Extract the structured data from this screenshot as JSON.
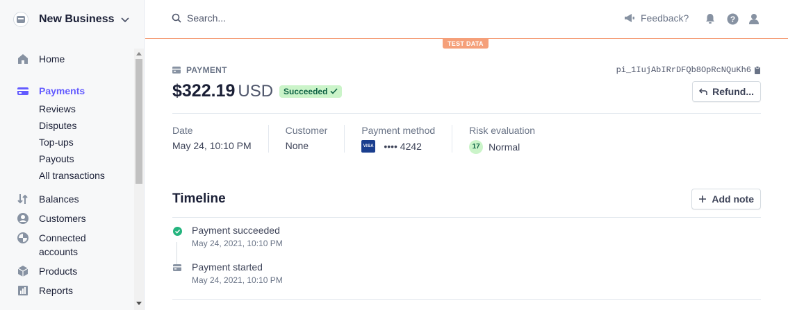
{
  "sidebar": {
    "business_name": "New Business",
    "items": [
      {
        "label": "Home",
        "icon": "home-icon"
      },
      {
        "label": "Payments",
        "icon": "payments-icon",
        "active": true
      },
      {
        "label": "Balances",
        "icon": "balances-icon"
      },
      {
        "label": "Customers",
        "icon": "customers-icon"
      },
      {
        "label": "Connected accounts",
        "icon": "connected-accounts-icon"
      },
      {
        "label": "Products",
        "icon": "products-icon"
      },
      {
        "label": "Reports",
        "icon": "reports-icon"
      }
    ],
    "payments_subitems": [
      "Reviews",
      "Disputes",
      "Top-ups",
      "Payouts",
      "All transactions"
    ],
    "connected_accounts_lines": [
      "Connected",
      "accounts"
    ]
  },
  "topbar": {
    "search_placeholder": "Search...",
    "feedback_label": "Feedback?",
    "test_data_badge": "TEST DATA"
  },
  "payment": {
    "section_label": "PAYMENT",
    "id": "pi_1IujAbIRrDFQb8OpRcNQuKh6",
    "amount": "$322.19",
    "currency": "USD",
    "status": "Succeeded",
    "refund_label": "Refund..."
  },
  "summary": {
    "date_label": "Date",
    "date_value": "May 24, 10:10 PM",
    "customer_label": "Customer",
    "customer_value": "None",
    "method_label": "Payment method",
    "card_brand": "VISA",
    "card_last4": "•••• 4242",
    "risk_label": "Risk evaluation",
    "risk_score": "17",
    "risk_value": "Normal"
  },
  "timeline": {
    "title": "Timeline",
    "add_note_label": "Add note",
    "events": [
      {
        "title": "Payment succeeded",
        "time": "May 24, 2021, 10:10 PM",
        "icon": "check-circle-icon"
      },
      {
        "title": "Payment started",
        "time": "May 24, 2021, 10:10 PM",
        "icon": "payment-started-icon"
      }
    ]
  },
  "colors": {
    "accent": "#635bff",
    "test_mode": "#f5a07a",
    "success_bg": "#cbf4c9",
    "success_fg": "#0e6245"
  }
}
